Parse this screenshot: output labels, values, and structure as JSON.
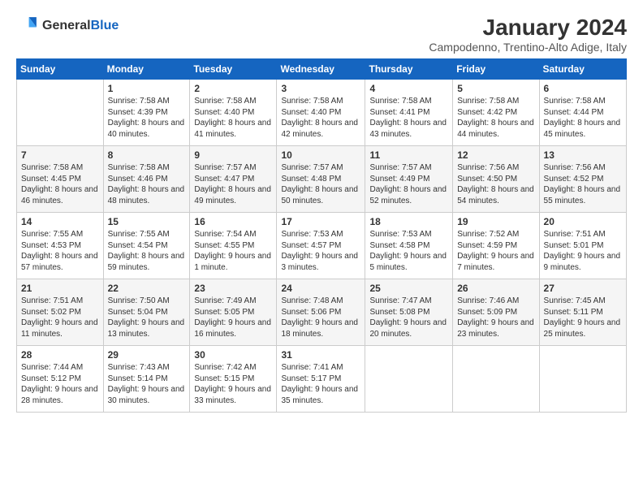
{
  "header": {
    "logo_general": "General",
    "logo_blue": "Blue",
    "title": "January 2024",
    "subtitle": "Campodenno, Trentino-Alto Adige, Italy"
  },
  "days_of_week": [
    "Sunday",
    "Monday",
    "Tuesday",
    "Wednesday",
    "Thursday",
    "Friday",
    "Saturday"
  ],
  "weeks": [
    [
      {
        "day": "",
        "info": ""
      },
      {
        "day": "1",
        "info": "Sunrise: 7:58 AM\nSunset: 4:39 PM\nDaylight: 8 hours\nand 40 minutes."
      },
      {
        "day": "2",
        "info": "Sunrise: 7:58 AM\nSunset: 4:40 PM\nDaylight: 8 hours\nand 41 minutes."
      },
      {
        "day": "3",
        "info": "Sunrise: 7:58 AM\nSunset: 4:40 PM\nDaylight: 8 hours\nand 42 minutes."
      },
      {
        "day": "4",
        "info": "Sunrise: 7:58 AM\nSunset: 4:41 PM\nDaylight: 8 hours\nand 43 minutes."
      },
      {
        "day": "5",
        "info": "Sunrise: 7:58 AM\nSunset: 4:42 PM\nDaylight: 8 hours\nand 44 minutes."
      },
      {
        "day": "6",
        "info": "Sunrise: 7:58 AM\nSunset: 4:44 PM\nDaylight: 8 hours\nand 45 minutes."
      }
    ],
    [
      {
        "day": "7",
        "info": "Sunrise: 7:58 AM\nSunset: 4:45 PM\nDaylight: 8 hours\nand 46 minutes."
      },
      {
        "day": "8",
        "info": "Sunrise: 7:58 AM\nSunset: 4:46 PM\nDaylight: 8 hours\nand 48 minutes."
      },
      {
        "day": "9",
        "info": "Sunrise: 7:57 AM\nSunset: 4:47 PM\nDaylight: 8 hours\nand 49 minutes."
      },
      {
        "day": "10",
        "info": "Sunrise: 7:57 AM\nSunset: 4:48 PM\nDaylight: 8 hours\nand 50 minutes."
      },
      {
        "day": "11",
        "info": "Sunrise: 7:57 AM\nSunset: 4:49 PM\nDaylight: 8 hours\nand 52 minutes."
      },
      {
        "day": "12",
        "info": "Sunrise: 7:56 AM\nSunset: 4:50 PM\nDaylight: 8 hours\nand 54 minutes."
      },
      {
        "day": "13",
        "info": "Sunrise: 7:56 AM\nSunset: 4:52 PM\nDaylight: 8 hours\nand 55 minutes."
      }
    ],
    [
      {
        "day": "14",
        "info": "Sunrise: 7:55 AM\nSunset: 4:53 PM\nDaylight: 8 hours\nand 57 minutes."
      },
      {
        "day": "15",
        "info": "Sunrise: 7:55 AM\nSunset: 4:54 PM\nDaylight: 8 hours\nand 59 minutes."
      },
      {
        "day": "16",
        "info": "Sunrise: 7:54 AM\nSunset: 4:55 PM\nDaylight: 9 hours\nand 1 minute."
      },
      {
        "day": "17",
        "info": "Sunrise: 7:53 AM\nSunset: 4:57 PM\nDaylight: 9 hours\nand 3 minutes."
      },
      {
        "day": "18",
        "info": "Sunrise: 7:53 AM\nSunset: 4:58 PM\nDaylight: 9 hours\nand 5 minutes."
      },
      {
        "day": "19",
        "info": "Sunrise: 7:52 AM\nSunset: 4:59 PM\nDaylight: 9 hours\nand 7 minutes."
      },
      {
        "day": "20",
        "info": "Sunrise: 7:51 AM\nSunset: 5:01 PM\nDaylight: 9 hours\nand 9 minutes."
      }
    ],
    [
      {
        "day": "21",
        "info": "Sunrise: 7:51 AM\nSunset: 5:02 PM\nDaylight: 9 hours\nand 11 minutes."
      },
      {
        "day": "22",
        "info": "Sunrise: 7:50 AM\nSunset: 5:04 PM\nDaylight: 9 hours\nand 13 minutes."
      },
      {
        "day": "23",
        "info": "Sunrise: 7:49 AM\nSunset: 5:05 PM\nDaylight: 9 hours\nand 16 minutes."
      },
      {
        "day": "24",
        "info": "Sunrise: 7:48 AM\nSunset: 5:06 PM\nDaylight: 9 hours\nand 18 minutes."
      },
      {
        "day": "25",
        "info": "Sunrise: 7:47 AM\nSunset: 5:08 PM\nDaylight: 9 hours\nand 20 minutes."
      },
      {
        "day": "26",
        "info": "Sunrise: 7:46 AM\nSunset: 5:09 PM\nDaylight: 9 hours\nand 23 minutes."
      },
      {
        "day": "27",
        "info": "Sunrise: 7:45 AM\nSunset: 5:11 PM\nDaylight: 9 hours\nand 25 minutes."
      }
    ],
    [
      {
        "day": "28",
        "info": "Sunrise: 7:44 AM\nSunset: 5:12 PM\nDaylight: 9 hours\nand 28 minutes."
      },
      {
        "day": "29",
        "info": "Sunrise: 7:43 AM\nSunset: 5:14 PM\nDaylight: 9 hours\nand 30 minutes."
      },
      {
        "day": "30",
        "info": "Sunrise: 7:42 AM\nSunset: 5:15 PM\nDaylight: 9 hours\nand 33 minutes."
      },
      {
        "day": "31",
        "info": "Sunrise: 7:41 AM\nSunset: 5:17 PM\nDaylight: 9 hours\nand 35 minutes."
      },
      {
        "day": "",
        "info": ""
      },
      {
        "day": "",
        "info": ""
      },
      {
        "day": "",
        "info": ""
      }
    ]
  ]
}
